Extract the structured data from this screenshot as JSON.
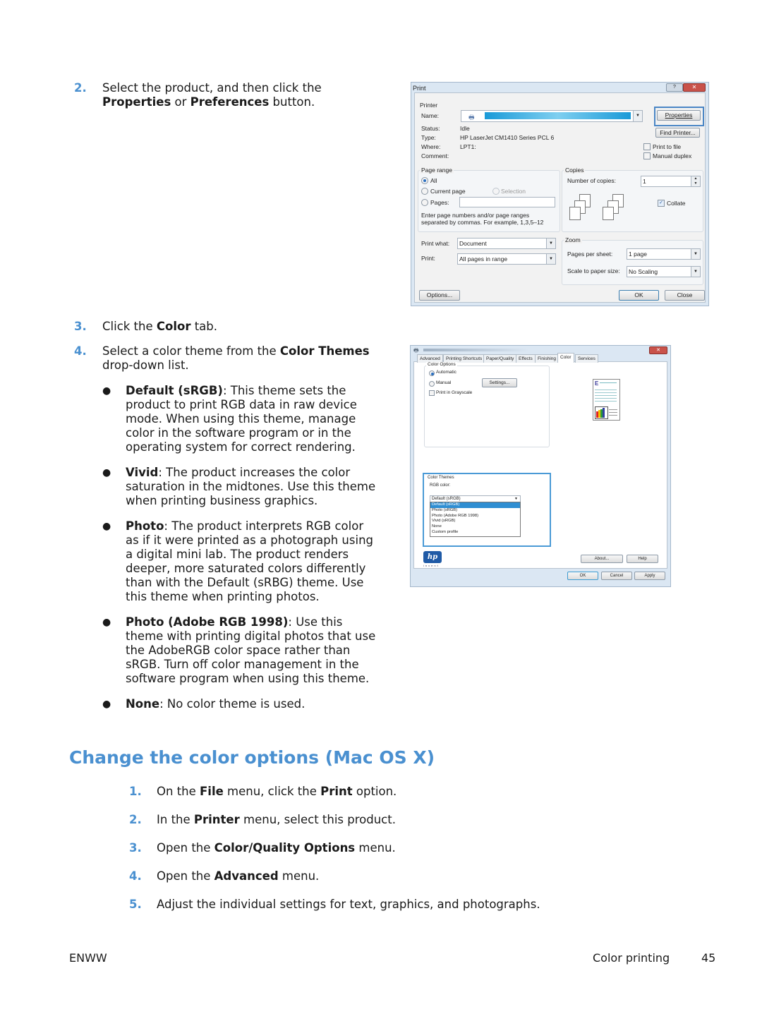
{
  "steps_top": [
    {
      "number": "2.",
      "parts": [
        [
          "Select the product, and then click the ",
          false
        ],
        [
          "Properties",
          true
        ],
        [
          " or ",
          false
        ],
        [
          "Preferences",
          true
        ],
        [
          " button.",
          false
        ]
      ]
    },
    {
      "number": "3.",
      "parts": [
        [
          "Click the ",
          false
        ],
        [
          "Color",
          true
        ],
        [
          " tab.",
          false
        ]
      ]
    },
    {
      "number": "4.",
      "parts": [
        [
          "Select a color theme from the ",
          false
        ],
        [
          "Color Themes",
          true
        ],
        [
          " drop-down list.",
          false
        ]
      ]
    }
  ],
  "step2": {
    "number": "2.",
    "line1": "Select the product, and then click the",
    "b1": "Properties",
    "mid": " or ",
    "b2": "Preferences",
    "tail": " button."
  },
  "step3": {
    "number": "3.",
    "pre": "Click the ",
    "bold": "Color",
    "post": " tab."
  },
  "step4": {
    "number": "4.",
    "pre": "Select a color theme from the ",
    "bold": "Color Themes",
    "post": "drop-down list."
  },
  "themes": [
    {
      "name": "Default (sRGB)",
      "desc_lines": [
        ": This theme sets the",
        "product to print RGB data in raw device",
        "mode. When using this theme, manage",
        "color in the software program or in the",
        "operating system for correct rendering."
      ]
    },
    {
      "name": "Vivid",
      "desc_lines": [
        ": The product increases the color",
        "saturation in the midtones. Use this theme",
        "when printing business graphics."
      ]
    },
    {
      "name": "Photo",
      "desc_lines": [
        ": The product interprets RGB color",
        "as if it were printed as a photograph using",
        "a digital mini lab. The product renders",
        "deeper, more saturated colors differently",
        "than with the Default (sRBG) theme. Use",
        "this theme when printing photos."
      ]
    },
    {
      "name": "Photo (Adobe RGB 1998)",
      "desc_lines": [
        ": Use this",
        "theme with printing digital photos that use",
        "the AdobeRGB color space rather than",
        "sRGB. Turn off color management in the",
        "software program when using this theme."
      ]
    },
    {
      "name": "None",
      "desc_lines": [
        ": No color theme is used."
      ]
    }
  ],
  "section_title": "Change the color options (Mac OS X)",
  "mac_steps": [
    {
      "number": "1.",
      "pre": "On the ",
      "b1": "File",
      "mid": " menu, click the ",
      "b2": "Print",
      "post": " option."
    },
    {
      "number": "2.",
      "pre": "In the ",
      "b1": "Printer",
      "mid": " menu, select this product.",
      "b2": "",
      "post": ""
    },
    {
      "number": "3.",
      "pre": "Open the ",
      "b1": "Color/Quality Options",
      "mid": " menu.",
      "b2": "",
      "post": ""
    },
    {
      "number": "4.",
      "pre": "Open the ",
      "b1": "Advanced",
      "mid": " menu.",
      "b2": "",
      "post": ""
    },
    {
      "number": "5.",
      "pre": "Adjust the individual settings for text, graphics, and photographs.",
      "b1": "",
      "mid": "",
      "b2": "",
      "post": ""
    }
  ],
  "footer": {
    "left": "ENWW",
    "section": "Color printing",
    "page": "45"
  },
  "print_dialog": {
    "title": "Print",
    "printer_group": "Printer",
    "name_label": "Name:",
    "status_label": "Status:",
    "status_value": "Idle",
    "type_label": "Type:",
    "type_value": "HP LaserJet CM1410 Series PCL 6",
    "where_label": "Where:",
    "where_value": "LPT1:",
    "comment_label": "Comment:",
    "properties_button": "Properties",
    "find_printer_button": "Find Printer...",
    "print_to_file": "Print to file",
    "manual_duplex": "Manual duplex",
    "page_range_group": "Page range",
    "all": "All",
    "current_page": "Current page",
    "selection": "Selection",
    "pages": "Pages:",
    "range_hint_1": "Enter page numbers and/or page ranges",
    "range_hint_2": "separated by commas.  For example, 1,3,5–12",
    "copies_group": "Copies",
    "copies_label": "Number of copies:",
    "copies_value": "1",
    "collate": "Collate",
    "print_what_label": "Print what:",
    "print_what_value": "Document",
    "print_label": "Print:",
    "print_value": "All pages in range",
    "zoom_group": "Zoom",
    "pages_per_sheet_label": "Pages per sheet:",
    "pages_per_sheet_value": "1 page",
    "scale_label": "Scale to paper size:",
    "scale_value": "No Scaling",
    "options_button": "Options...",
    "ok_button": "OK",
    "close_button": "Close"
  },
  "properties_dialog": {
    "tabs": [
      "Advanced",
      "Printing Shortcuts",
      "Paper/Quality",
      "Effects",
      "Finishing",
      "Color",
      "Services"
    ],
    "active_tab": "Color",
    "color_options_group": "Color Options",
    "automatic": "Automatic",
    "manual": "Manual",
    "settings_button": "Settings...",
    "grayscale": "Print in Grayscale",
    "color_themes_group": "Color Themes",
    "rgb_label": "RGB color:",
    "rgb_selected": "Default (sRGB)",
    "rgb_options": [
      "Default (sRGB)",
      "Photo (sRGB)",
      "Photo (Adobe RGB 1998)",
      "Vivid (sRGB)",
      "None",
      "Custom profile"
    ],
    "logo": "hp",
    "logo_tag": "invent",
    "about_button": "About...",
    "help_button": "Help",
    "ok_button": "OK",
    "cancel_button": "Cancel",
    "apply_button": "Apply"
  }
}
